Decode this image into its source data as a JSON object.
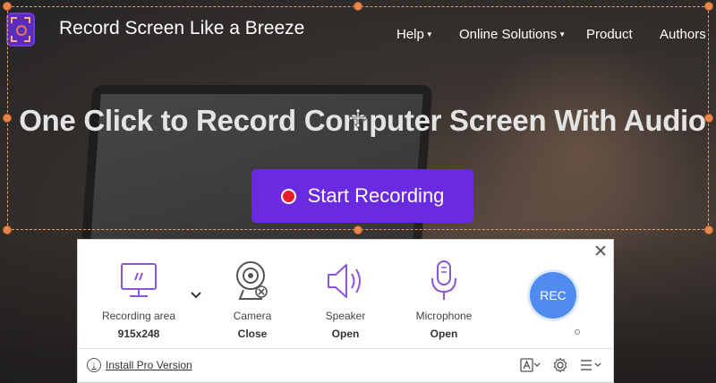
{
  "header": {
    "site_title": "Record Screen Like a Breeze",
    "nav": [
      {
        "label": "Help",
        "has_dropdown": true
      },
      {
        "label": "Online Solutions",
        "has_dropdown": true
      },
      {
        "label": "Product",
        "has_dropdown": false
      },
      {
        "label": "Authors",
        "has_dropdown": false
      }
    ]
  },
  "hero": {
    "title": "One Click to Record Computer Screen With Audio",
    "start_button": "Start Recording"
  },
  "recorder": {
    "tools": [
      {
        "label": "Recording area",
        "value": "915x248",
        "icon": "monitor-icon"
      },
      {
        "label": "Camera",
        "value": "Close",
        "icon": "webcam-icon"
      },
      {
        "label": "Speaker",
        "value": "Open",
        "icon": "speaker-icon"
      },
      {
        "label": "Microphone",
        "value": "Open",
        "icon": "microphone-icon"
      }
    ],
    "rec_button": "REC",
    "install_link": "Install Pro Version"
  },
  "colors": {
    "accent": "#6a2be0",
    "rec_blue": "#4f8bf0",
    "selection": "#e8874c"
  }
}
